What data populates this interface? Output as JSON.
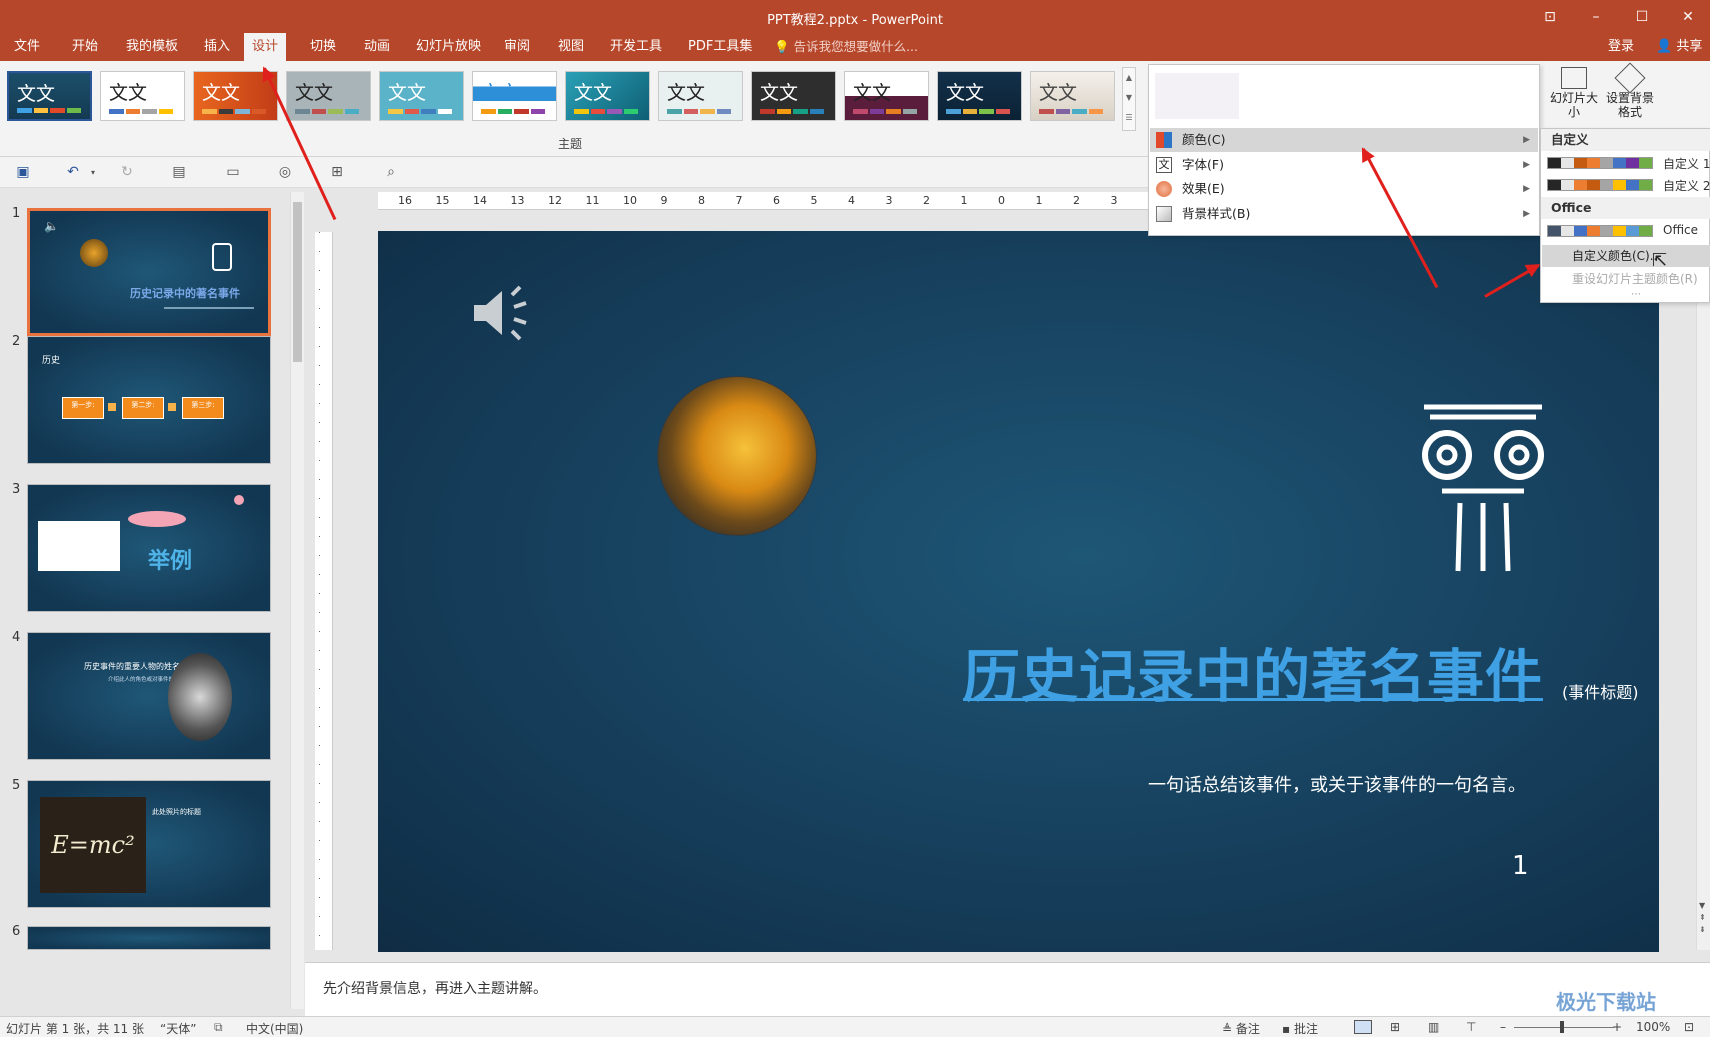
{
  "window": {
    "title": "PPT教程2.pptx - PowerPoint"
  },
  "menu": {
    "tabs": [
      "文件",
      "开始",
      "我的模板",
      "插入",
      "设计",
      "切换",
      "动画",
      "幻灯片放映",
      "审阅",
      "视图",
      "开发工具",
      "PDF工具集"
    ],
    "active": "设计",
    "tell_me": "告诉我您想要做什么...",
    "login": "登录",
    "share": "共享"
  },
  "ribbon": {
    "theme_label": "文文",
    "group_label": "主题",
    "slide_size": "幻灯片大小",
    "format_bg": "设置背景格式"
  },
  "variants_menu": {
    "items": [
      {
        "label": "颜色(C)",
        "icon": "color-swatch-icon"
      },
      {
        "label": "字体(F)",
        "icon": "font-icon"
      },
      {
        "label": "效果(E)",
        "icon": "effects-icon"
      },
      {
        "label": "背景样式(B)",
        "icon": "background-style-icon"
      }
    ],
    "highlighted": "颜色(C)"
  },
  "colors_submenu": {
    "custom_heading": "自定义",
    "custom": [
      {
        "name": "自定义 1",
        "colors": [
          "#262626",
          "#e7e6e6",
          "#c55a11",
          "#ed7d31",
          "#a5a5a5",
          "#4472c4",
          "#7030a0",
          "#70ad47"
        ]
      },
      {
        "name": "自定义 2",
        "colors": [
          "#262626",
          "#e7e6e6",
          "#ed7d31",
          "#c55a11",
          "#a5a5a5",
          "#ffc000",
          "#4472c4",
          "#70ad47"
        ]
      }
    ],
    "office_heading": "Office",
    "office": [
      {
        "name": "Office",
        "colors": [
          "#44546a",
          "#e7e6e6",
          "#4472c4",
          "#ed7d31",
          "#a5a5a5",
          "#ffc000",
          "#5b9bd5",
          "#70ad47"
        ]
      }
    ],
    "action_custom": "自定义颜色(C)...",
    "action_reset": "重设幻灯片主题颜色(R)"
  },
  "slides": {
    "numbers": [
      "1",
      "2",
      "3",
      "4",
      "5",
      "6"
    ],
    "thumb2": {
      "title": "历史",
      "steps": [
        "第一步:",
        "第二步:",
        "第三步:"
      ]
    },
    "thumb3": {
      "title": "举例"
    },
    "thumb4": {
      "title": "历史事件的重要人物的姓名",
      "sub": "介绍此人的角色或对事件的影响。"
    },
    "thumb5": {
      "title": "此处照片的标题",
      "formula": "E=mc²"
    }
  },
  "slide": {
    "title": "历史记录中的著名事件",
    "title_note": "(事件标题)",
    "subtitle": "一句话总结该事件，或关于该事件的一句名言。",
    "number": "1"
  },
  "notes": "先介绍背景信息，再进入主题讲解。",
  "status": {
    "slide_info": "幻灯片 第 1 张，共 11 张",
    "theme": "“天体”",
    "language": "中文(中国)",
    "notes_btn": "备注",
    "comments_btn": "批注",
    "zoom": "100%"
  },
  "ruler_labels": [
    "16",
    "15",
    "14",
    "13",
    "12",
    "11",
    "10",
    "9",
    "8",
    "7",
    "6",
    "5",
    "4",
    "3",
    "2",
    "1",
    "0",
    "1",
    "2",
    "3"
  ],
  "watermark": "极光下载站"
}
